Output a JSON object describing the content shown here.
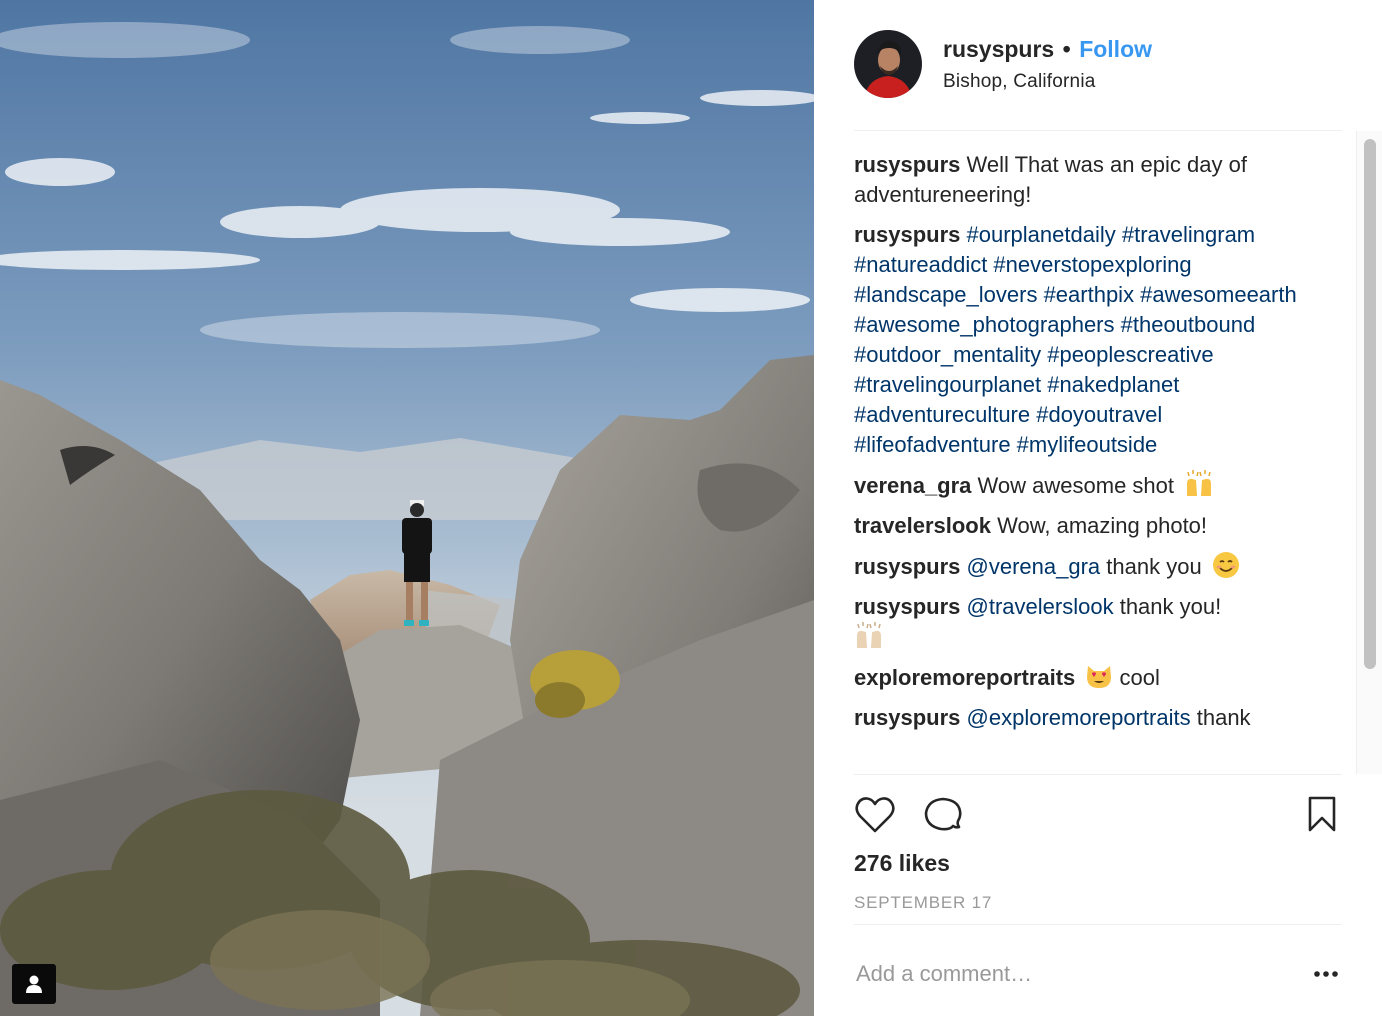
{
  "post": {
    "username": "rusyspurs",
    "separator": "•",
    "follow_label": "Follow",
    "location": "Bishop, California"
  },
  "comments": [
    {
      "user": "rusyspurs",
      "text": "Well That was an epic day of adventureneering!"
    },
    {
      "user": "rusyspurs",
      "hashtags": "#ourplanetdaily #travelingram #natureaddict #neverstopexploring #landscape_lovers #earthpix #awesomeearth #awesome_photographers #theoutbound #outdoor_mentality #peoplescreative #travelingourplanet #nakedplanet #adventureculture #doyoutravel #lifeofadventure #mylifeoutside"
    },
    {
      "user": "verena_gra",
      "text": "Wow awesome shot",
      "emoji": "raising-hands-icon"
    },
    {
      "user": "travelerslook",
      "text": "Wow, amazing photo!"
    },
    {
      "user": "rusyspurs",
      "mention": "@verena_gra",
      "text": "thank you",
      "emoji": "smiling-face-icon"
    },
    {
      "user": "rusyspurs",
      "mention": "@travelerslook",
      "text": "thank you!",
      "emoji": "raising-hands-light-icon"
    },
    {
      "user": "exploremoreportraits",
      "text": "cool",
      "emoji": "heart-eyes-cat-icon"
    },
    {
      "user": "rusyspurs",
      "mention": "@exploremoreportraits",
      "text": "thank"
    }
  ],
  "actions": {
    "like_icon": "heart-icon",
    "comment_icon": "comment-bubble-icon",
    "save_icon": "bookmark-icon"
  },
  "likes": "276 likes",
  "date": "SEPTEMBER 17",
  "comment_box": {
    "placeholder": "Add a comment…",
    "more_icon": "more-options-icon"
  },
  "photo": {
    "tag_icon": "user-tag-icon"
  },
  "colors": {
    "link": "#3897f0",
    "hashtag": "#003569",
    "text": "#262626",
    "muted": "#999999"
  }
}
